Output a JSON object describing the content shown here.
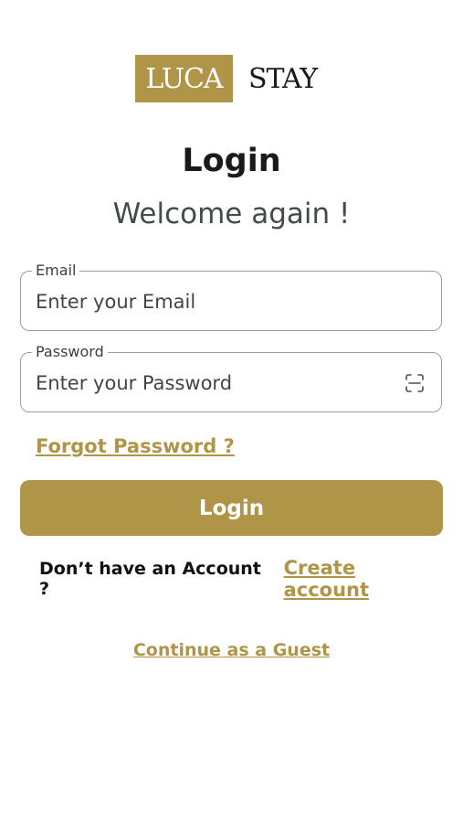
{
  "brand": {
    "logo_box_text": "LUCA",
    "logo_text": "STAY",
    "accent_color": "#b09548"
  },
  "header": {
    "title": "Login",
    "subtitle": "Welcome again !"
  },
  "form": {
    "email": {
      "label": "Email",
      "value": "",
      "placeholder": "Enter your Email"
    },
    "password": {
      "label": "Password",
      "value": "",
      "placeholder": "Enter your Password",
      "toggle_icon": "eye-icon"
    },
    "forgot_label": "Forgot Password ?",
    "submit_label": "Login"
  },
  "signup": {
    "prompt": "Don’t have an Account ?",
    "link_label": "Create account"
  },
  "guest": {
    "link_label": "Continue as a Guest"
  }
}
